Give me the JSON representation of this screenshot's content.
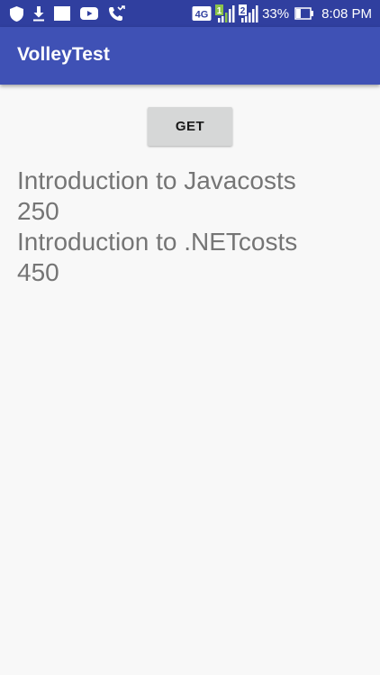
{
  "status_bar": {
    "icons_left": [
      "shield-icon",
      "download-icon",
      "image-icon",
      "youtube-icon",
      "missed-call-icon"
    ],
    "network_label": "4G",
    "sim1_label": "1",
    "sim2_label": "2",
    "battery_percent": "33%",
    "battery_level": 0.33,
    "time": "8:08 PM"
  },
  "app_bar": {
    "title": "VolleyTest"
  },
  "get_button": {
    "label": "GET"
  },
  "response": {
    "lines": [
      "Introduction to Javacosts",
      "250",
      "Introduction to .NETcosts",
      "450"
    ]
  },
  "colors": {
    "status_bar": "#303f9f",
    "app_bar": "#3f51b5",
    "background": "#f8f8f8",
    "button": "#d6d7d7",
    "text_gray": "#757575"
  }
}
